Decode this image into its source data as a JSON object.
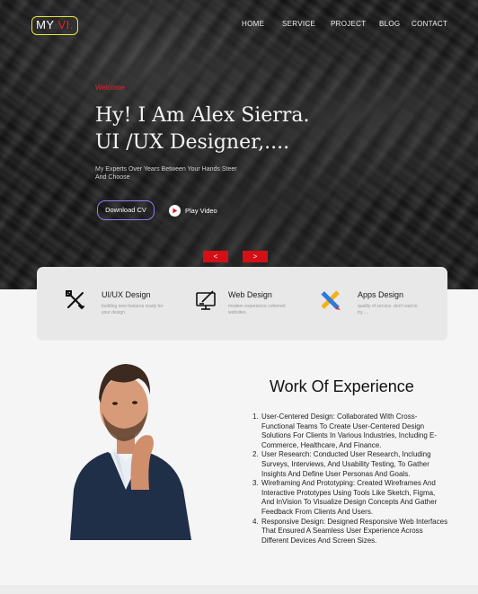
{
  "logo": {
    "text": "MY",
    "accent": "VI."
  },
  "nav": {
    "home": "HOME",
    "service": "SERVICE",
    "project": "PROJECT",
    "blog": "BLOG",
    "contact": "CONTACT"
  },
  "hero": {
    "welcome": "Welcome",
    "headline_line1": "Hy! I Am Alex Sierra.",
    "headline_line2": "UI /UX Designer,....",
    "tagline": "My Experts Over Years Between Your Hands Steer And Choose",
    "download_label": "Download CV",
    "play_label": "Play Video",
    "prev_label": "<",
    "next_label": ">"
  },
  "services": [
    {
      "title": "UI/UX Design",
      "desc": "building new features ready for your design.",
      "icon": "design-tools-icon"
    },
    {
      "title": "Web Design",
      "desc": "modern experience coherent websites.",
      "icon": "monitor-pen-icon"
    },
    {
      "title": "Apps Design",
      "desc": "quality of service. don't wait to try,....",
      "icon": "pencil-ruler-icon"
    }
  ],
  "experience": {
    "title": "Work Of Experience",
    "items": [
      "User-Centered Design: Collaborated With Cross-Functional Teams To Create User-Centered Design Solutions For Clients In Various Industries, Including E-Commerce, Healthcare, And Finance.",
      "User Research: Conducted User Research, Including Surveys, Interviews, And Usability Testing, To Gather Insights And Define User Personas And Goals.",
      "Wireframing And Prototyping: Created Wireframes And Interactive Prototypes Using Tools Like Sketch, Figma, And InVision To Visualize Design Concepts And Gather Feedback From Clients And Users.",
      "Responsive Design: Designed Responsive Web Interfaces That Ensured A Seamless User Experience Across Different Devices And Screen Sizes."
    ]
  },
  "colors": {
    "accent_red": "#e0242a",
    "logo_border": "#e5e53a",
    "cv_border": "#8c7df0"
  }
}
